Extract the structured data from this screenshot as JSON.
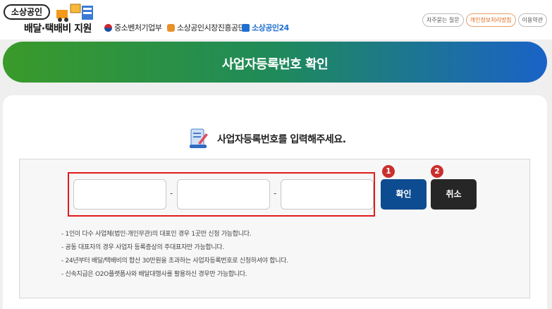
{
  "header": {
    "logo_badge": "소상공인",
    "logo_sub": "배달·택배비 지원",
    "agencies": [
      {
        "label": "중소벤처기업부"
      },
      {
        "label": "소상공인시장진흥공단"
      },
      {
        "label": "소상공인24"
      }
    ],
    "top_links": [
      "자주묻는 질문",
      "개인정보처리방침",
      "이용약관"
    ]
  },
  "banner": {
    "title": "사업자등록번호 확인"
  },
  "form": {
    "prompt": "사업자등록번호를 입력해주세요.",
    "inputs": [
      {
        "value": "",
        "placeholder": ""
      },
      {
        "value": "",
        "placeholder": ""
      },
      {
        "value": "",
        "placeholder": ""
      }
    ],
    "separator": "-",
    "confirm_label": "확인",
    "cancel_label": "취소",
    "badge_1": "1",
    "badge_2": "2"
  },
  "notes": [
    "1인이 다수 사업체(법인·개인무관)의 대표인 경우 1곳만 신청 가능합니다.",
    "공동 대표자의 경우 사업자 등록증상의 주대표자만 가능합니다.",
    "24년부터 배달/택배비의 합산 30만원을 초과하는 사업자등록번호로 신청하셔야 합니다.",
    "신속지급은 O2O플랫폼사와 배달대행사를 활용하신 경우만 가능합니다."
  ],
  "colors": {
    "banner_start": "#3a9a2a",
    "banner_end": "#1a62c8",
    "confirm_button": "#0e4c91",
    "cancel_button": "#262626",
    "highlight_frame": "#e01b1b",
    "badge": "#c9302c"
  },
  "icons": [
    "delivery-truck-icon",
    "document-pen-icon"
  ]
}
